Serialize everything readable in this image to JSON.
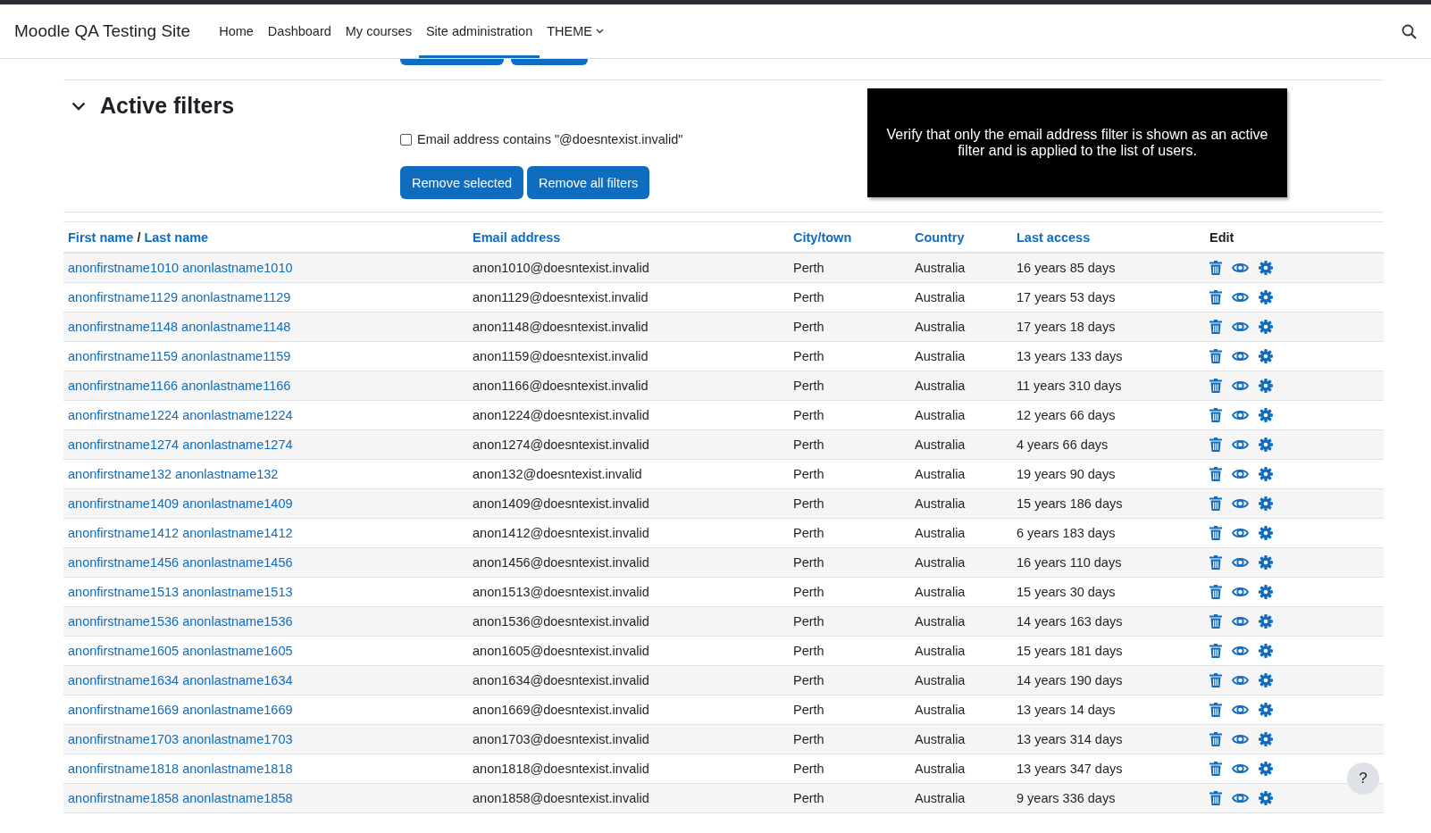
{
  "navbar": {
    "site_name": "Moodle QA Testing Site",
    "items": [
      {
        "label": "Home",
        "selected": false
      },
      {
        "label": "Dashboard",
        "selected": false
      },
      {
        "label": "My courses",
        "selected": false
      },
      {
        "label": "Site administration",
        "selected": true
      },
      {
        "label": "THEME",
        "selected": false,
        "dropdown": true
      }
    ]
  },
  "active_filters": {
    "title": "Active filters",
    "expanded": true,
    "filters": [
      {
        "label": "Email address contains \"@doesntexist.invalid\"",
        "checked": false
      }
    ],
    "buttons": [
      "Remove selected",
      "Remove all filters"
    ]
  },
  "note": "Verify that only the email address filter is shown as an active filter and is applied to the list of users.",
  "table": {
    "columns": [
      {
        "label": "First name",
        "kind": "name"
      },
      {
        "label": "Email address",
        "kind": "link"
      },
      {
        "label": "City/town",
        "kind": "link"
      },
      {
        "label": "Country",
        "kind": "link"
      },
      {
        "label": "Last access",
        "kind": "link"
      },
      {
        "label": "Edit",
        "kind": "plain"
      }
    ],
    "name_separator": "/",
    "name_second": "Last name",
    "rows": [
      {
        "name": "anonfirstname1010 anonlastname1010",
        "email": "anon1010@doesntexist.invalid",
        "city": "Perth",
        "country": "Australia",
        "last_access": "16 years 85 days"
      },
      {
        "name": "anonfirstname1129 anonlastname1129",
        "email": "anon1129@doesntexist.invalid",
        "city": "Perth",
        "country": "Australia",
        "last_access": "17 years 53 days"
      },
      {
        "name": "anonfirstname1148 anonlastname1148",
        "email": "anon1148@doesntexist.invalid",
        "city": "Perth",
        "country": "Australia",
        "last_access": "17 years 18 days"
      },
      {
        "name": "anonfirstname1159 anonlastname1159",
        "email": "anon1159@doesntexist.invalid",
        "city": "Perth",
        "country": "Australia",
        "last_access": "13 years 133 days"
      },
      {
        "name": "anonfirstname1166 anonlastname1166",
        "email": "anon1166@doesntexist.invalid",
        "city": "Perth",
        "country": "Australia",
        "last_access": "11 years 310 days"
      },
      {
        "name": "anonfirstname1224 anonlastname1224",
        "email": "anon1224@doesntexist.invalid",
        "city": "Perth",
        "country": "Australia",
        "last_access": "12 years 66 days"
      },
      {
        "name": "anonfirstname1274 anonlastname1274",
        "email": "anon1274@doesntexist.invalid",
        "city": "Perth",
        "country": "Australia",
        "last_access": "4 years 66 days"
      },
      {
        "name": "anonfirstname132 anonlastname132",
        "email": "anon132@doesntexist.invalid",
        "city": "Perth",
        "country": "Australia",
        "last_access": "19 years 90 days"
      },
      {
        "name": "anonfirstname1409 anonlastname1409",
        "email": "anon1409@doesntexist.invalid",
        "city": "Perth",
        "country": "Australia",
        "last_access": "15 years 186 days"
      },
      {
        "name": "anonfirstname1412 anonlastname1412",
        "email": "anon1412@doesntexist.invalid",
        "city": "Perth",
        "country": "Australia",
        "last_access": "6 years 183 days"
      },
      {
        "name": "anonfirstname1456 anonlastname1456",
        "email": "anon1456@doesntexist.invalid",
        "city": "Perth",
        "country": "Australia",
        "last_access": "16 years 110 days"
      },
      {
        "name": "anonfirstname1513 anonlastname1513",
        "email": "anon1513@doesntexist.invalid",
        "city": "Perth",
        "country": "Australia",
        "last_access": "15 years 30 days"
      },
      {
        "name": "anonfirstname1536 anonlastname1536",
        "email": "anon1536@doesntexist.invalid",
        "city": "Perth",
        "country": "Australia",
        "last_access": "14 years 163 days"
      },
      {
        "name": "anonfirstname1605 anonlastname1605",
        "email": "anon1605@doesntexist.invalid",
        "city": "Perth",
        "country": "Australia",
        "last_access": "15 years 181 days"
      },
      {
        "name": "anonfirstname1634 anonlastname1634",
        "email": "anon1634@doesntexist.invalid",
        "city": "Perth",
        "country": "Australia",
        "last_access": "14 years 190 days"
      },
      {
        "name": "anonfirstname1669 anonlastname1669",
        "email": "anon1669@doesntexist.invalid",
        "city": "Perth",
        "country": "Australia",
        "last_access": "13 years 14 days"
      },
      {
        "name": "anonfirstname1703 anonlastname1703",
        "email": "anon1703@doesntexist.invalid",
        "city": "Perth",
        "country": "Australia",
        "last_access": "13 years 314 days"
      },
      {
        "name": "anonfirstname1818 anonlastname1818",
        "email": "anon1818@doesntexist.invalid",
        "city": "Perth",
        "country": "Australia",
        "last_access": "13 years 347 days"
      },
      {
        "name": "anonfirstname1858 anonlastname1858",
        "email": "anon1858@doesntexist.invalid",
        "city": "Perth",
        "country": "Australia",
        "last_access": "9 years 336 days"
      }
    ]
  },
  "help_button": "?"
}
